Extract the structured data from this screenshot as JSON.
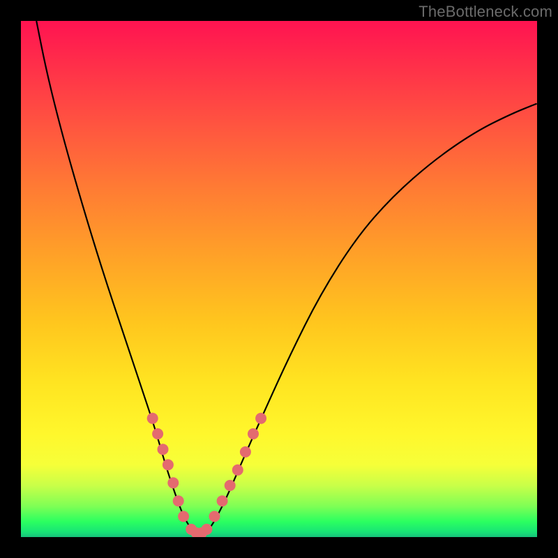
{
  "watermark": "TheBottleneck.com",
  "colors": {
    "background": "#000000",
    "gradient_top": "#ff1351",
    "gradient_bottom": "#17c37c",
    "curve": "#000000",
    "dot": "#e46a6f"
  },
  "chart_data": {
    "type": "line",
    "title": "",
    "xlabel": "",
    "ylabel": "",
    "xlim": [
      0,
      100
    ],
    "ylim": [
      0,
      100
    ],
    "series": [
      {
        "name": "bottleneck-curve",
        "x": [
          3,
          5,
          8,
          12,
          16,
          20,
          23,
          26,
          28,
          30,
          31.5,
          33,
          34,
          35,
          36.5,
          38,
          40,
          43,
          47,
          52,
          58,
          65,
          72,
          80,
          88,
          95,
          100
        ],
        "y": [
          100,
          90,
          78,
          64,
          51,
          39,
          30,
          21,
          14,
          8,
          4,
          1.5,
          0.5,
          0.5,
          1.5,
          4,
          8,
          15,
          24,
          35,
          47,
          58,
          66,
          73,
          78.5,
          82,
          84
        ]
      }
    ],
    "scatter_points": {
      "name": "highlight-dots",
      "left_branch": [
        {
          "x": 25.5,
          "y": 23
        },
        {
          "x": 26.5,
          "y": 20
        },
        {
          "x": 27.5,
          "y": 17
        },
        {
          "x": 28.5,
          "y": 14
        },
        {
          "x": 29.5,
          "y": 10.5
        },
        {
          "x": 30.5,
          "y": 7
        },
        {
          "x": 31.5,
          "y": 4
        },
        {
          "x": 33.0,
          "y": 1.5
        },
        {
          "x": 34.0,
          "y": 0.8
        },
        {
          "x": 35.0,
          "y": 0.8
        },
        {
          "x": 36.0,
          "y": 1.5
        }
      ],
      "right_branch": [
        {
          "x": 37.5,
          "y": 4
        },
        {
          "x": 39.0,
          "y": 7
        },
        {
          "x": 40.5,
          "y": 10
        },
        {
          "x": 42.0,
          "y": 13
        },
        {
          "x": 43.5,
          "y": 16.5
        },
        {
          "x": 45.0,
          "y": 20
        },
        {
          "x": 46.5,
          "y": 23
        }
      ]
    }
  }
}
